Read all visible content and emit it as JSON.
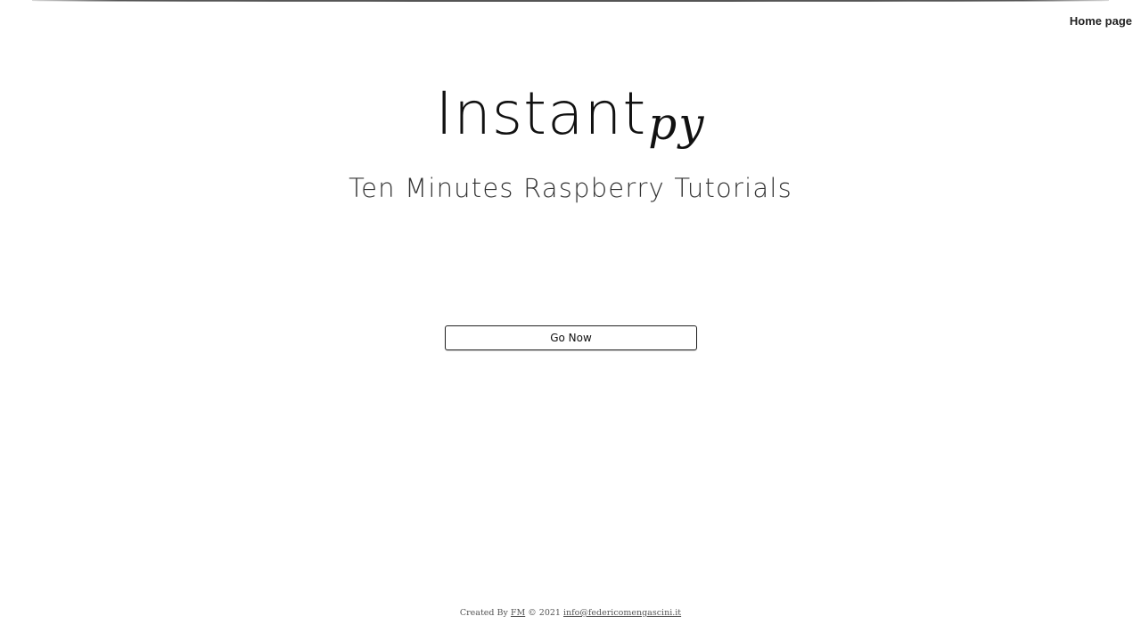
{
  "header": {
    "nav_link": "Home page"
  },
  "hero": {
    "title_main": "Instant",
    "title_suffix": "py",
    "subtitle": "Ten Minutes Raspberry Tutorials"
  },
  "actions": {
    "go_label": "Go Now"
  },
  "footer": {
    "created_by_prefix": "Created By",
    "author_link": "FM",
    "copyright_text": "© 2021",
    "email_link": "info@federicomengascini.it"
  },
  "colors": {
    "background": "#ffffff",
    "text": "#111111",
    "subtitle": "#333333",
    "footer_text": "#555555"
  }
}
